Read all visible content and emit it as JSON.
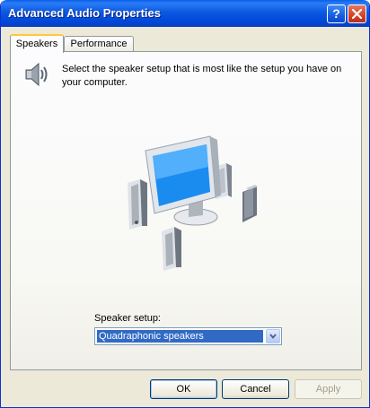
{
  "window": {
    "title": "Advanced Audio Properties",
    "help_label": "?"
  },
  "tabs": [
    {
      "label": "Speakers",
      "selected": true
    },
    {
      "label": "Performance",
      "selected": false
    }
  ],
  "speakers": {
    "icon": "speaker-icon",
    "description": "Select the speaker setup that is most like the setup you have on your computer.",
    "setup_label": "Speaker setup:",
    "setup_value": "Quadraphonic speakers"
  },
  "buttons": {
    "ok": "OK",
    "cancel": "Cancel",
    "apply": "Apply"
  }
}
